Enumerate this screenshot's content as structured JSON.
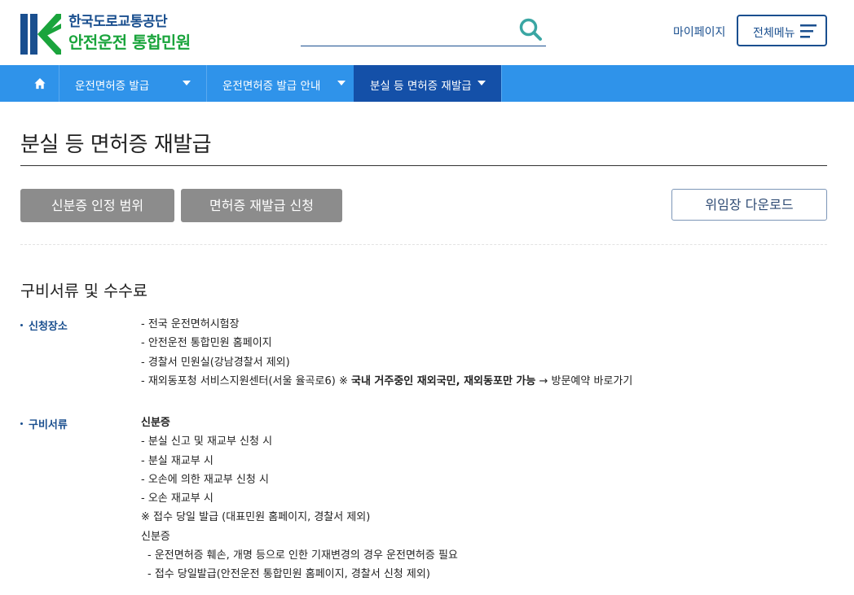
{
  "header": {
    "logo_line1": "한국도로교통공단",
    "logo_line2": "안전운전 통합민원",
    "search_placeholder": "",
    "mypage_label": "마이페이지",
    "allmenu_label": "전체메뉴"
  },
  "nav": {
    "home_icon": "home-icon",
    "items": [
      {
        "label": "운전면허증 발급"
      },
      {
        "label": "운전면허증 발급 안내"
      },
      {
        "label": "분실 등 면허증 재발급"
      }
    ]
  },
  "page": {
    "title": "분실 등 면허증 재발급",
    "buttons": {
      "identity": "신분증 인정 범위",
      "reissue": "면허증 재발급 신청",
      "download": "위임장 다운로드"
    }
  },
  "section": {
    "title": "구비서류 및 수수료",
    "place": {
      "label": "신청장소",
      "lines": [
        "- 전국 운전면허시험장",
        "- 안전운전 통합민원 홈페이지",
        "- 경찰서 민원실(강남경찰서 제외)"
      ],
      "overseas_prefix": "- 재외동포청 서비스지원센터(서울 율곡로6) ※ ",
      "overseas_bold": "국내 거주중인 재외국민, 재외동포만 가능",
      "overseas_suffix": " → 방문예약 바로가기"
    },
    "docs": {
      "label": "구비서류",
      "lines": [
        "신분증",
        "- 분실 신고 및 재교부 신청 시",
        "- 분실 재교부 시",
        "- 오손에 의한 재교부 신청 시",
        "- 오손 재교부 시",
        "※ 접수 당일 발급 (대표민원 홈페이지, 경찰서 제외)",
        "신분증",
        "- 운전면허증 훼손, 개명 등으로 인한 기재변경의 경우 운전면허증 필요",
        "- 접수 당일발급(안전운전 통합민원 홈페이지, 경찰서 신청 제외)"
      ]
    }
  },
  "colors": {
    "brand_blue": "#1a4f8f",
    "brand_green": "#1aa43c",
    "nav_bg": "#2f93ea",
    "nav_active": "#1450a8",
    "button_gray": "#8c8c8c"
  }
}
